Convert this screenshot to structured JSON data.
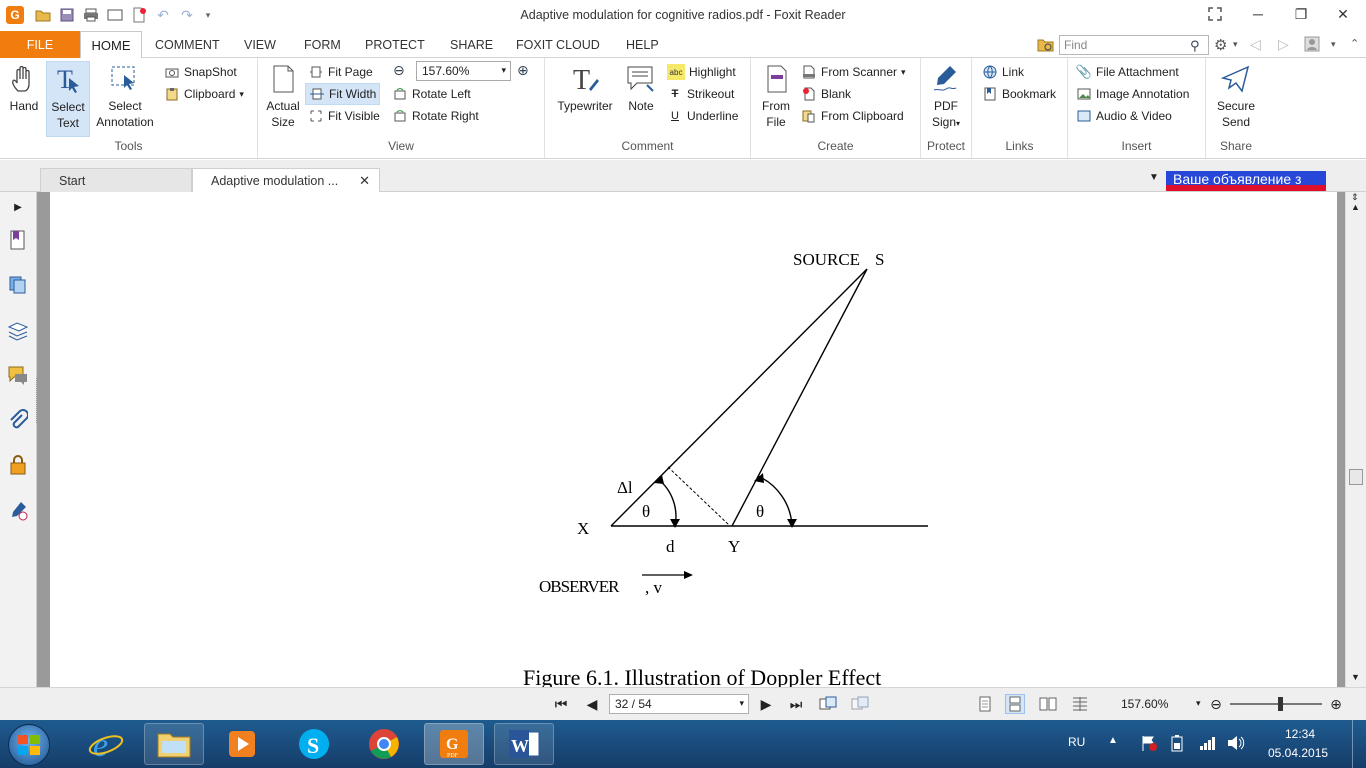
{
  "window": {
    "title": "Adaptive modulation for cognitive radios.pdf - Foxit Reader",
    "minimize": "─",
    "maximize": "❐",
    "close": "✕"
  },
  "menu": {
    "file": "FILE",
    "items": [
      "HOME",
      "COMMENT",
      "VIEW",
      "FORM",
      "PROTECT",
      "SHARE",
      "FOXIT CLOUD",
      "HELP"
    ],
    "find_placeholder": "Find"
  },
  "ribbon": {
    "tools": {
      "label": "Tools",
      "hand": "Hand",
      "select_text_1": "Select",
      "select_text_2": "Text",
      "select_annotation_1": "Select",
      "select_annotation_2": "Annotation",
      "snapshot": "SnapShot",
      "clipboard": "Clipboard"
    },
    "view": {
      "label": "View",
      "actual_size_1": "Actual",
      "actual_size_2": "Size",
      "fit_page": "Fit Page",
      "fit_width": "Fit Width",
      "fit_visible": "Fit Visible",
      "zoom_value": "157.60%",
      "rotate_left": "Rotate Left",
      "rotate_right": "Rotate Right"
    },
    "comment": {
      "label": "Comment",
      "typewriter": "Typewriter",
      "note": "Note",
      "highlight": "Highlight",
      "strikeout": "Strikeout",
      "underline": "Underline"
    },
    "create": {
      "label": "Create",
      "from_file_1": "From",
      "from_file_2": "File",
      "from_scanner": "From Scanner",
      "blank": "Blank",
      "from_clipboard": "From Clipboard"
    },
    "protect": {
      "label": "Protect",
      "pdf_sign_1": "PDF",
      "pdf_sign_2": "Sign"
    },
    "links": {
      "label": "Links",
      "link": "Link",
      "bookmark": "Bookmark"
    },
    "insert": {
      "label": "Insert",
      "file_attachment": "File Attachment",
      "image_annotation": "Image Annotation",
      "audio_video": "Audio & Video"
    },
    "share": {
      "label": "Share",
      "secure_send_1": "Secure",
      "secure_send_2": "Send"
    }
  },
  "tabs": {
    "start": "Start",
    "document": "Adaptive modulation ...",
    "ad_text": "Ваше объявление з"
  },
  "figure": {
    "source": "SOURCE",
    "source_s": "S",
    "delta_l": "Δl",
    "theta_1": "θ",
    "theta_2": "θ",
    "x": "X",
    "d": "d",
    "y": "Y",
    "observer": "OBSERVER",
    "velocity": ", v",
    "caption": "Figure 6.1.  Illustration of Doppler Effect"
  },
  "statusbar": {
    "page_indicator": "32 / 54",
    "zoom": "157.60%"
  },
  "taskbar": {
    "language": "RU",
    "time": "12:34",
    "date": "05.04.2015"
  },
  "colors": {
    "accent_orange": "#f07d0e",
    "taskbar_blue": "#1f5b8f"
  }
}
